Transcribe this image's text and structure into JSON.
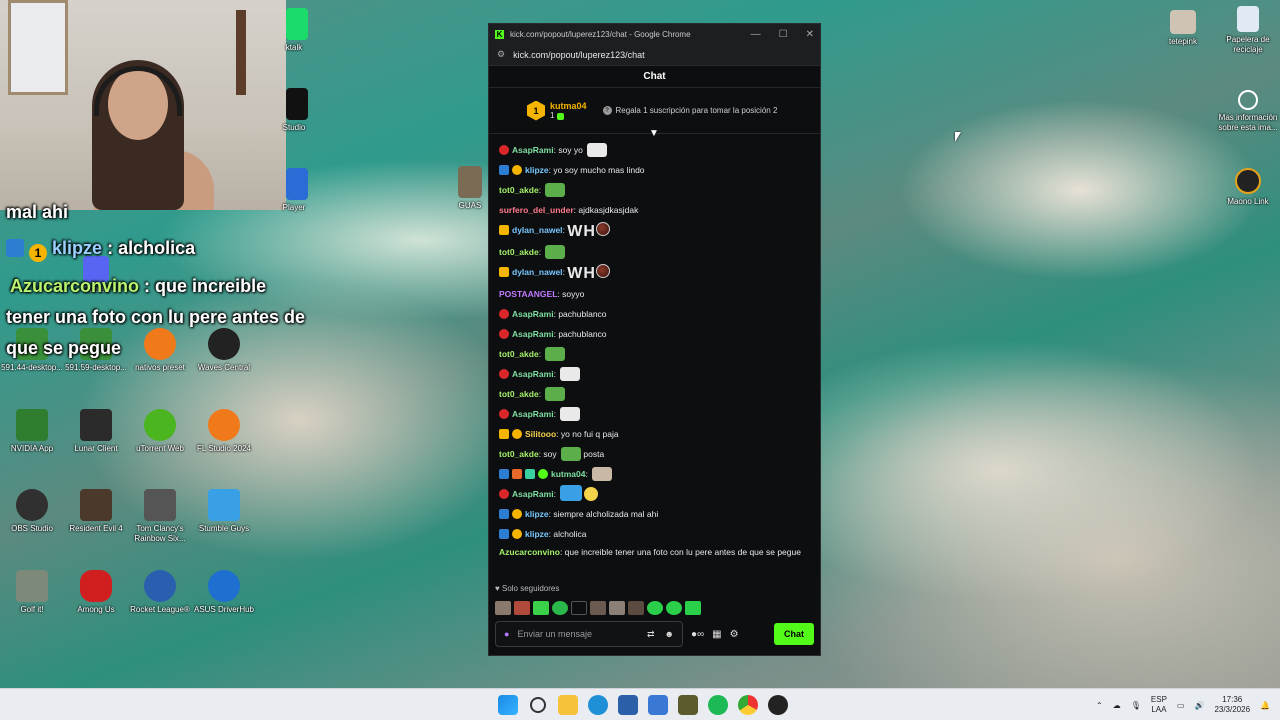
{
  "stream_overlay": {
    "line1": "mal ahi",
    "line2_user": "klipze",
    "line2_badge": "1",
    "line2_text": ": alcholica",
    "line3_user": "Azucarconvino",
    "line3_text": ": que increible",
    "line4": "tener una foto con lu pere antes de",
    "line5": "que se pegue"
  },
  "desktop_icons": [
    {
      "label": "ktalk",
      "color": "#1bdc6a"
    },
    {
      "label": "Studio",
      "color": "#111111"
    },
    {
      "label": "Player",
      "color": "#2a6bd6"
    },
    {
      "label": "GUAS",
      "color": "#7a6b55"
    },
    {
      "label": "Games",
      "color": "#5865f2"
    },
    {
      "label": "591.44-desktop...",
      "color": "#3a8f3a"
    },
    {
      "label": "591.59-desktop...",
      "color": "#3a8f3a"
    },
    {
      "label": "nativos preset",
      "color": "#f07a1a"
    },
    {
      "label": "Waves Central",
      "color": "#222222"
    },
    {
      "label": "NVIDIA App",
      "color": "#2f7d2f"
    },
    {
      "label": "Lunar Client",
      "color": "#2b2b2b"
    },
    {
      "label": "uTorrent Web",
      "color": "#4ab51e"
    },
    {
      "label": "FL Studio 2024",
      "color": "#f07a1a"
    },
    {
      "label": "OBS Studio",
      "color": "#303030"
    },
    {
      "label": "Resident Evil 4",
      "color": "#4b3a2b"
    },
    {
      "label": "Tom Clancy's Rainbow Six...",
      "color": "#555555"
    },
    {
      "label": "Stumble Guys",
      "color": "#3aa0e6"
    },
    {
      "label": "Golf it!",
      "color": "#7d8a7a"
    },
    {
      "label": "Among Us",
      "color": "#d11f1f"
    },
    {
      "label": "Rocket League®",
      "color": "#2a5fb0"
    },
    {
      "label": "ASUS DriverHub",
      "color": "#1f6fd1"
    },
    {
      "label": "tetepink",
      "color": "#cfc4b4"
    },
    {
      "label": "Papelera de reciclaje",
      "color": "#dfeaf5"
    },
    {
      "label": "Mas información sobre esta ima...",
      "color": "#2c3e50"
    },
    {
      "label": "Maono Link",
      "color": "#e6a21a"
    }
  ],
  "browser": {
    "title": "kick.com/popout/luperez123/chat - Google Chrome",
    "url": "kick.com/popout/luperez123/chat"
  },
  "chat": {
    "header": "Chat",
    "pinned": {
      "rank": "1",
      "user": "kutma04",
      "count": "1",
      "gift_text": "Regala 1 suscripción para tomar la posición 2"
    },
    "messages": [
      {
        "user": "AsapRami",
        "text": "soy yo",
        "ucolor": "#7ee0a1"
      },
      {
        "user": "klipze",
        "text": "yo soy mucho mas lindo",
        "ucolor": "#79c8ff"
      },
      {
        "user": "tot0_akde",
        "text": "",
        "ucolor": "#a4f06b"
      },
      {
        "user": "surfero_del_under",
        "text": "ajdkasjdkasjdak",
        "ucolor": "#ff7a8a"
      },
      {
        "user": "dylan_nawel",
        "text": "WH",
        "ucolor": "#79c8ff"
      },
      {
        "user": "tot0_akde",
        "text": "",
        "ucolor": "#a4f06b"
      },
      {
        "user": "dylan_nawel",
        "text": "WH",
        "ucolor": "#79c8ff"
      },
      {
        "user": "POSTAANGEL",
        "text": "soyyo",
        "ucolor": "#c07bff"
      },
      {
        "user": "AsapRami",
        "text": "pachublanco",
        "ucolor": "#7ee0a1"
      },
      {
        "user": "AsapRami",
        "text": "pachublanco",
        "ucolor": "#7ee0a1"
      },
      {
        "user": "tot0_akde",
        "text": "",
        "ucolor": "#a4f06b"
      },
      {
        "user": "AsapRami",
        "text": "",
        "ucolor": "#7ee0a1"
      },
      {
        "user": "tot0_akde",
        "text": "",
        "ucolor": "#a4f06b"
      },
      {
        "user": "AsapRami",
        "text": "",
        "ucolor": "#7ee0a1"
      },
      {
        "user": "Silitooo",
        "text": "yo no fui q paja",
        "ucolor": "#f5d34a"
      },
      {
        "user": "tot0_akde",
        "text": "soy",
        "text2": "posta",
        "ucolor": "#a4f06b"
      },
      {
        "user": "kutma04",
        "text": "",
        "ucolor": "#7ee0a1"
      },
      {
        "user": "AsapRami",
        "text": "",
        "ucolor": "#7ee0a1"
      },
      {
        "user": "klipze",
        "text": "siempre alcholizada mal ahi",
        "ucolor": "#79c8ff"
      },
      {
        "user": "klipze",
        "text": "alcholica",
        "ucolor": "#79c8ff"
      },
      {
        "user": "Azucarconvino",
        "text": "que increible tener una foto con lu pere antes de que se pegue",
        "ucolor": "#a4f06b"
      }
    ],
    "followers_only": "Solo seguidores",
    "input_placeholder": "Enviar un mensaje",
    "send_label": "Chat"
  },
  "taskbar": {
    "lang_top": "ESP",
    "lang_bottom": "LAA",
    "time": "17:36",
    "date": "23/3/2026"
  }
}
